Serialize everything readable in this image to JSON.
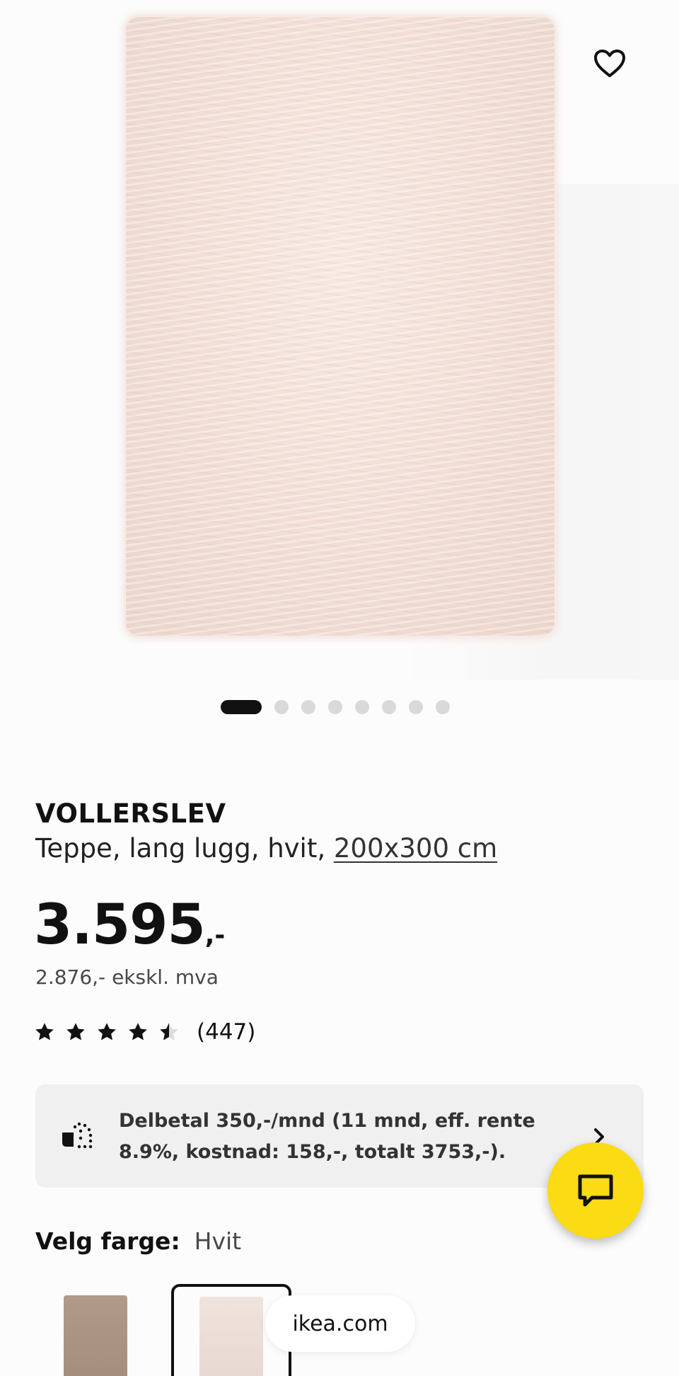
{
  "gallery": {
    "image_alt": "VOLLERSLEV rug image",
    "dot_count": 8,
    "active_index": 0
  },
  "product": {
    "name": "VOLLERSLEV",
    "description_prefix": "Teppe, lang lugg, hvit, ",
    "size": "200x300 cm",
    "price_main": "3.595",
    "price_suffix": ",-",
    "price_ex_vat": "2.876,- ekskl. mva",
    "rating": 4.5,
    "rating_max": 5,
    "review_count": "(447)"
  },
  "financing": {
    "text": "Delbetal 350,-/mnd (11 mnd, eff. rente 8.9%, kostnad: 158,-, totalt 3753,-)."
  },
  "color_select": {
    "label": "Velg farge:",
    "value": "Hvit",
    "swatches": [
      {
        "name": "beige",
        "color": "#a8917e",
        "selected": false
      },
      {
        "name": "hvit",
        "color": "#ece0d8",
        "selected": true
      }
    ]
  },
  "browser": {
    "url": "ikea.com"
  },
  "colors": {
    "chat_button": "#fadb14",
    "finance_bg": "#f0f0f0",
    "text": "#111111"
  }
}
